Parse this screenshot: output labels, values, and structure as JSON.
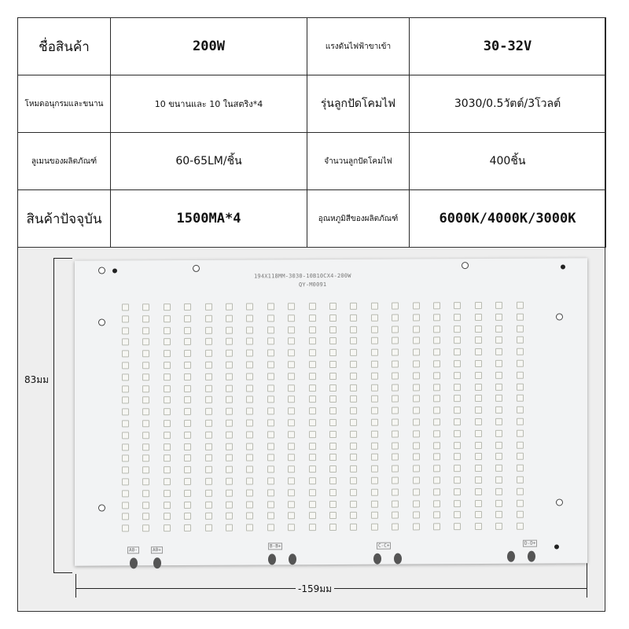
{
  "table": {
    "rows": [
      [
        {
          "text": "ชื่อสินค้า",
          "style": "lbl-lg"
        },
        {
          "text": "200W",
          "style": "val-bold"
        },
        {
          "text": "แรงดันไฟฟ้าขาเข้า",
          "style": "lbl-sm"
        },
        {
          "text": "30-32V",
          "style": "val-bold"
        }
      ],
      [
        {
          "text": "โหมดอนุกรมและขนาน",
          "style": "lbl-sm"
        },
        {
          "text": "10 ขนานและ 10 ในสตริง*4",
          "style": "val-sm"
        },
        {
          "text": "รุ่นลูกปัดโคมไฟ",
          "style": "val-mid"
        },
        {
          "text": "3030/0.5วัตต์/3โวลต์",
          "style": "val-mid"
        }
      ],
      [
        {
          "text": "ลูเมนของผลิตภัณฑ์",
          "style": "lbl-sm"
        },
        {
          "text": "60-65LM/ชิ้น",
          "style": "val-mid"
        },
        {
          "text": "จำนวนลูกปัดโคมไฟ",
          "style": "lbl-sm"
        },
        {
          "text": "400ชิ้น",
          "style": "val-mid"
        }
      ],
      [
        {
          "text": "สินค้าปัจจุบัน",
          "style": "lbl-lg"
        },
        {
          "text": "1500MA*4",
          "style": "val-bold"
        },
        {
          "text": "อุณหภูมิสีของผลิตภัณฑ์",
          "style": "lbl-sm"
        },
        {
          "text": "6000K/4000K/3000K",
          "style": "val-bold"
        }
      ]
    ]
  },
  "board": {
    "model_text": "194X118MM-3030-10B10CX4-200W",
    "sub_text": "QY-M0091",
    "pad_labels": [
      "A0-",
      "A0+",
      "B-B+",
      "C-C+",
      "D-D+"
    ],
    "led_columns": 20,
    "led_rows": 20,
    "led_color": "#f7f7f4"
  },
  "dimensions": {
    "height_label": "83มม",
    "width_label": "-159มม"
  }
}
